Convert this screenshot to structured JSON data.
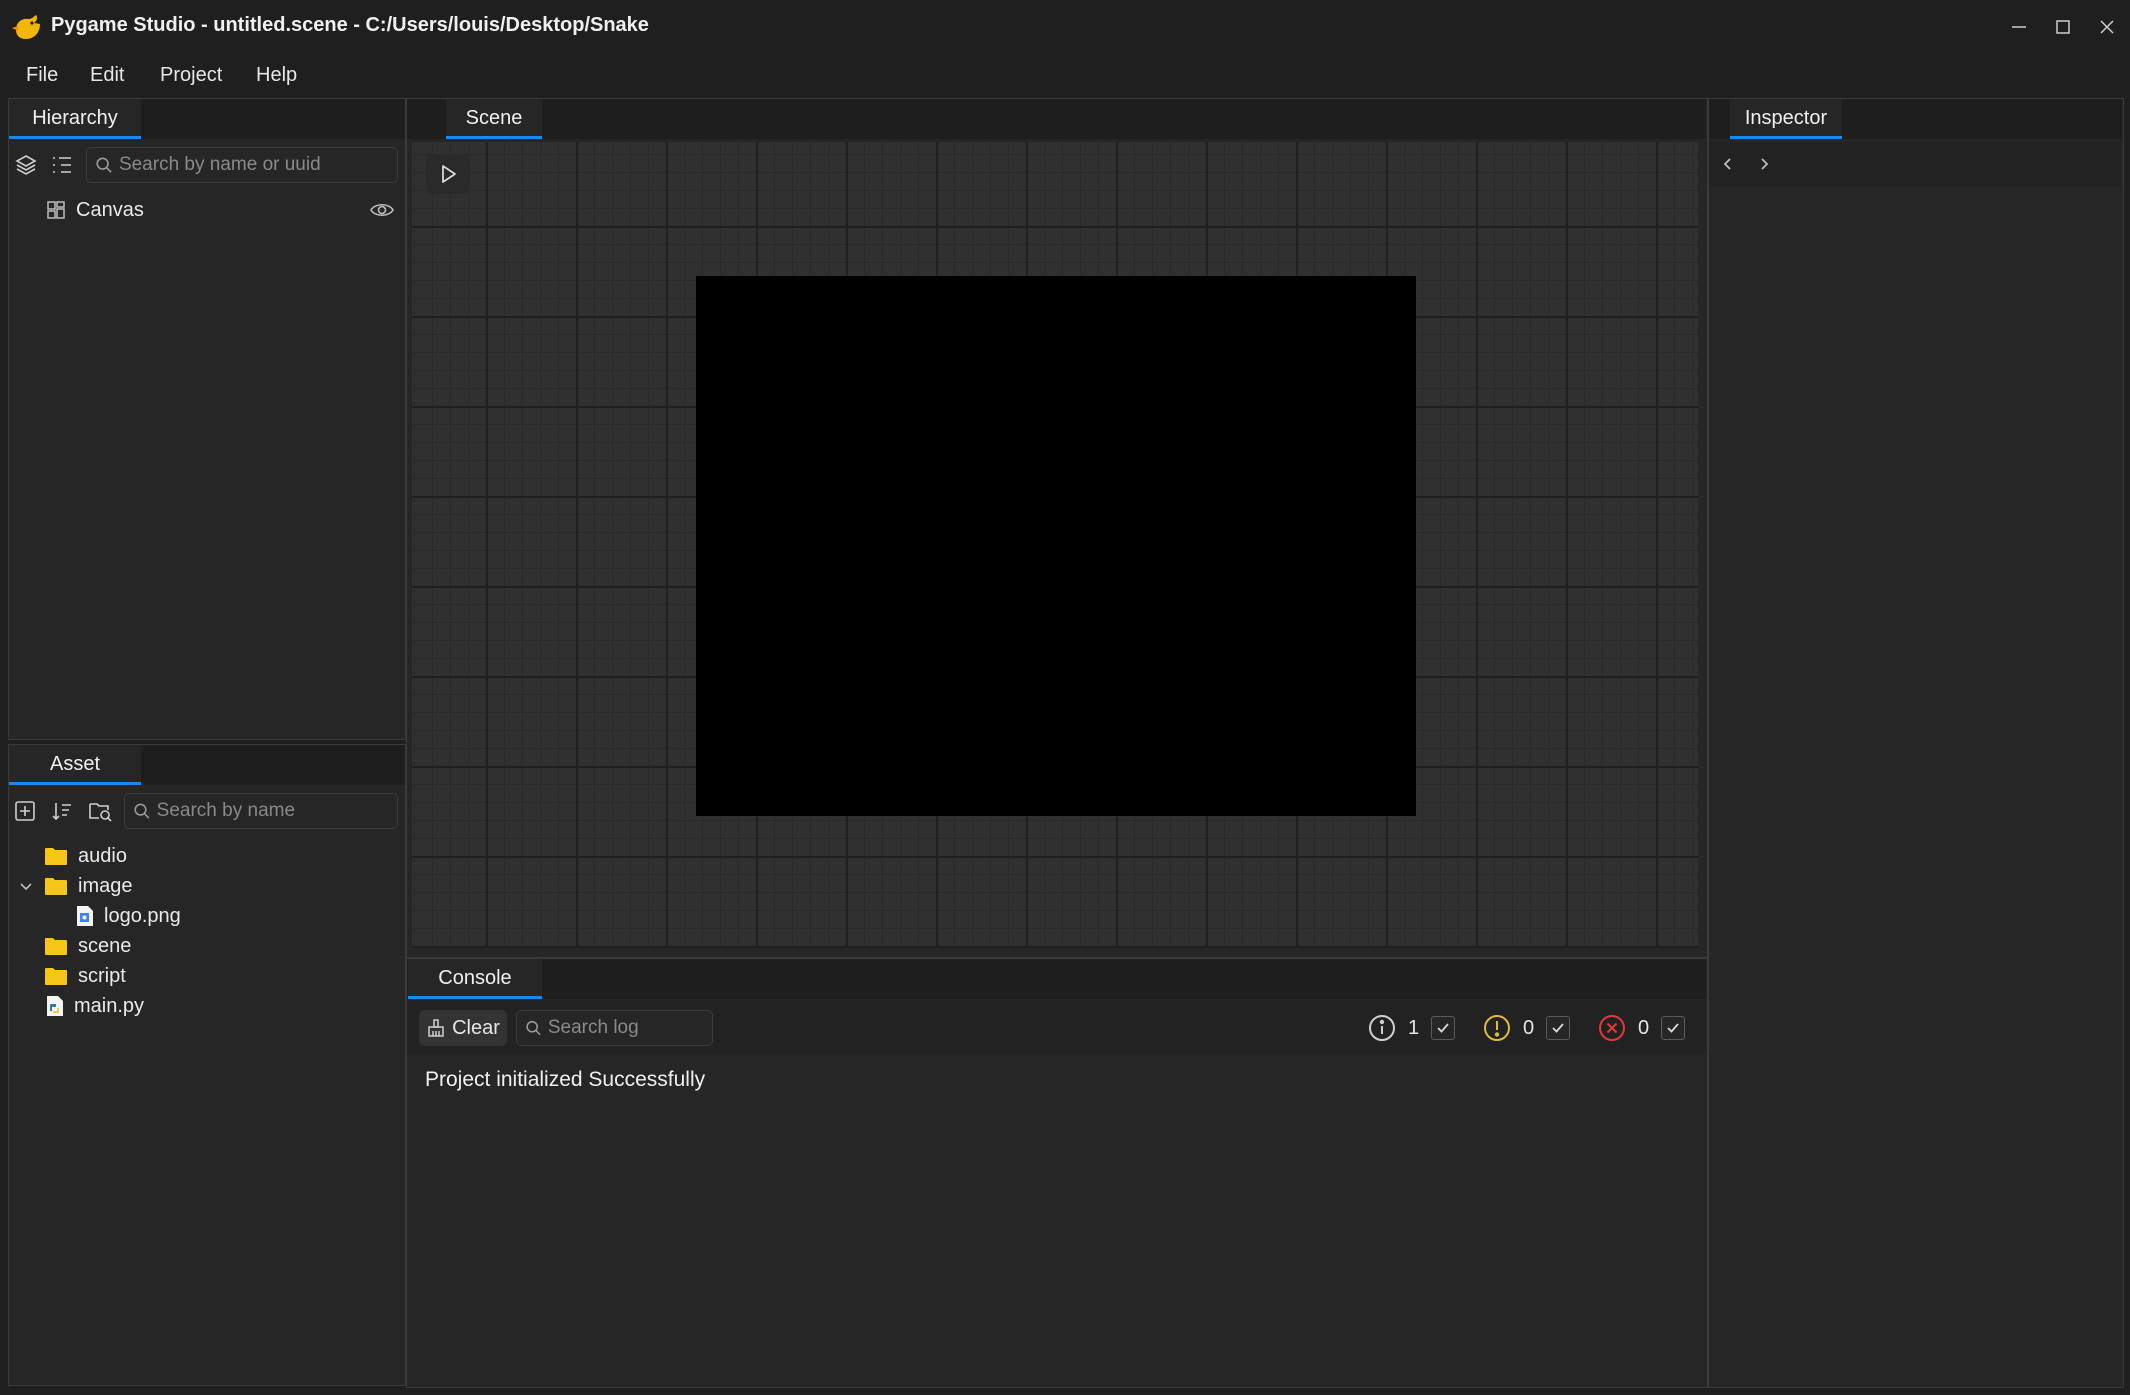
{
  "window": {
    "title": "Pygame Studio - untitled.scene - C:/Users/louis/Desktop/Snake",
    "controls": [
      "minimize-icon",
      "maximize-icon",
      "close-icon"
    ]
  },
  "menu": {
    "items": [
      "File",
      "Edit",
      "Project",
      "Help"
    ]
  },
  "hierarchy": {
    "tab": "Hierarchy",
    "search_placeholder": "Search by name or uuid",
    "items": [
      {
        "label": "Canvas",
        "icon": "canvas-grid-icon",
        "visible": true
      }
    ]
  },
  "asset": {
    "tab": "Asset",
    "search_placeholder": "Search by name",
    "items": [
      {
        "label": "audio",
        "icon": "folder-icon"
      },
      {
        "label": "image",
        "icon": "folder-icon",
        "expanded": true
      },
      {
        "label": "logo.png",
        "icon": "image-file-icon"
      },
      {
        "label": "scene",
        "icon": "folder-icon"
      },
      {
        "label": "script",
        "icon": "folder-icon"
      },
      {
        "label": "main.py",
        "icon": "python-file-icon"
      }
    ]
  },
  "scene": {
    "tab": "Scene"
  },
  "inspector": {
    "tab": "Inspector"
  },
  "console": {
    "tab": "Console",
    "clear_label": "Clear",
    "search_placeholder": "Search log",
    "counts": {
      "info": "1",
      "warning": "0",
      "error": "0"
    },
    "log": [
      "Project initialized Successfully"
    ]
  },
  "colors": {
    "accent": "#1e88e5",
    "warning": "#e2b93b",
    "error": "#e53935",
    "background": "#1f1f1f"
  }
}
